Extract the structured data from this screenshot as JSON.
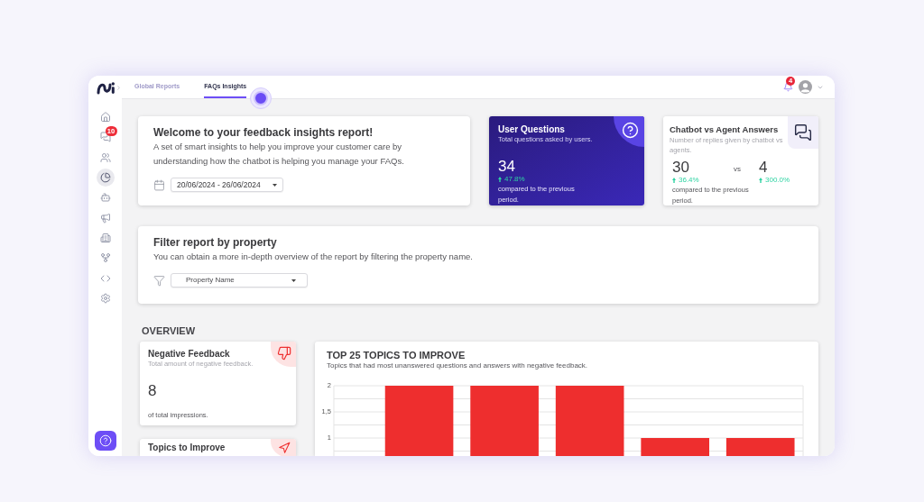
{
  "header": {
    "tabs": [
      {
        "label": "Global Reports",
        "selected": false
      },
      {
        "label": "FAQs Insights",
        "selected": true
      }
    ],
    "notification_count": "4"
  },
  "sidebar": {
    "items": [
      {
        "selected": false
      },
      {
        "selected": false,
        "badge": "10"
      },
      {
        "selected": false
      },
      {
        "selected": true
      },
      {
        "selected": false
      },
      {
        "selected": false
      },
      {
        "selected": false
      },
      {
        "selected": false
      },
      {
        "selected": false
      },
      {
        "selected": false
      }
    ]
  },
  "welcome_card": {
    "title": "Welcome to your feedback insights report!",
    "description": "A set of smart insights to help you improve your customer care by understanding how the chatbot is helping you manage your FAQs.",
    "date_range": "20/06/2024 - 26/06/2024"
  },
  "user_questions_card": {
    "title": "User Questions",
    "subtitle": "Total questions asked by users.",
    "value": "34",
    "trend_up": true,
    "change": "47.8%",
    "note": "compared to the previous period."
  },
  "answers_card": {
    "title": "Chatbot vs Agent Answers",
    "subtitle": "Number of replies given by chatbot vs agents.",
    "stats": [
      {
        "value": "30",
        "trend_up": true,
        "change": "36.4%"
      },
      {
        "value": "4",
        "trend_up": true,
        "change": "300.0%"
      }
    ],
    "separator": "vs",
    "note": "compared to the previous period."
  },
  "filter_card": {
    "title": "Filter report by property",
    "description": "You can obtain a more in-depth overview of the report by filtering the property name.",
    "property_select": {
      "placeholder": "Property Name"
    }
  },
  "overview": {
    "heading": "OVERVIEW",
    "metric_cards": [
      {
        "title": "Negative Feedback",
        "subtitle": "Total amount of negative feedback.",
        "value": "8",
        "note": "of total impressions."
      },
      {
        "title": "Topics to Improve"
      }
    ],
    "topics_chart": {
      "title": "TOP 25 TOPICS TO IMPROVE",
      "subtitle": "Topics that had most unanswered questions and answers with negative feedback.",
      "chart_data": {
        "type": "bar",
        "values": [
          2,
          2,
          2,
          1,
          1
        ],
        "ylim": [
          0.65,
          2
        ],
        "yticks": [
          1,
          {
            "value": 1.5,
            "label": "1,5"
          },
          2
        ]
      }
    }
  }
}
